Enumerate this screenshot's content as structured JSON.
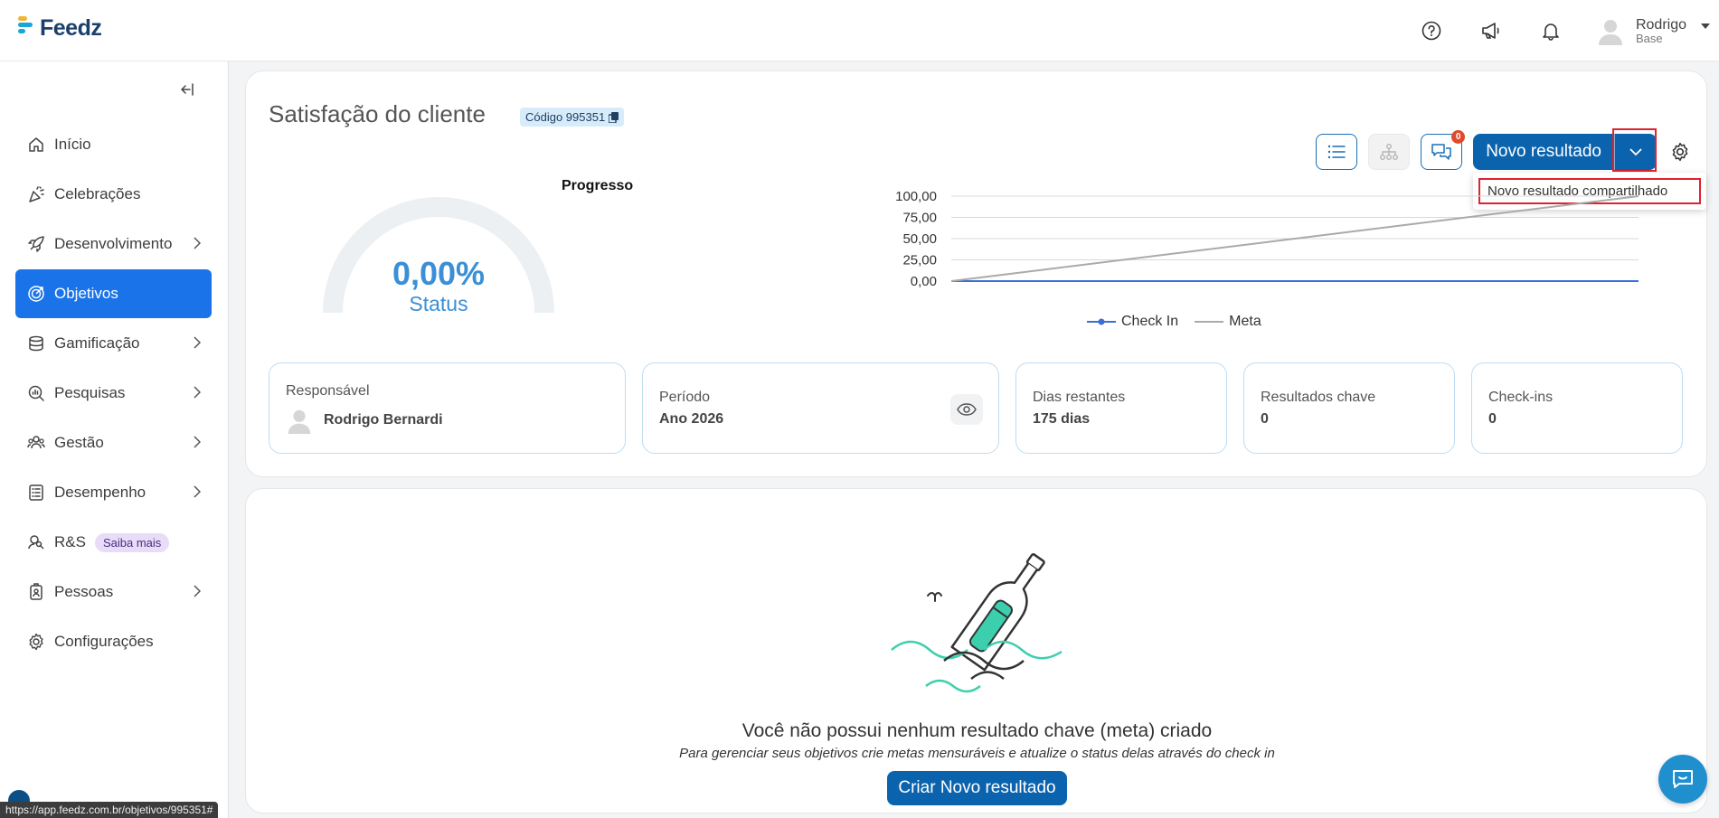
{
  "app": {
    "logo_text": "Feedz"
  },
  "header": {
    "user_name": "Rodrigo",
    "user_sub": "Base"
  },
  "sidebar": {
    "items": [
      {
        "label": "Início",
        "icon": "home-icon",
        "has_children": false
      },
      {
        "label": "Celebrações",
        "icon": "party-icon",
        "has_children": false
      },
      {
        "label": "Desenvolvimento",
        "icon": "rocket-icon",
        "has_children": true
      },
      {
        "label": "Objetivos",
        "icon": "target-icon",
        "has_children": false,
        "active": true
      },
      {
        "label": "Gamificação",
        "icon": "coins-icon",
        "has_children": true
      },
      {
        "label": "Pesquisas",
        "icon": "survey-icon",
        "has_children": true
      },
      {
        "label": "Gestão",
        "icon": "team-icon",
        "has_children": true
      },
      {
        "label": "Desempenho",
        "icon": "checklist-icon",
        "has_children": true
      },
      {
        "label": "R&S",
        "icon": "recruit-icon",
        "has_children": false,
        "badge": "Saiba mais"
      },
      {
        "label": "Pessoas",
        "icon": "badge-icon",
        "has_children": true
      },
      {
        "label": "Configurações",
        "icon": "gear-icon",
        "has_children": false
      }
    ]
  },
  "status_url": "https://app.feedz.com.br/objetivos/995351#",
  "objective": {
    "title": "Satisfação do cliente",
    "code_label": "Código 995351",
    "actions": {
      "notification_count": "0",
      "new_result_label": "Novo resultado",
      "dropdown_item": "Novo resultado compartilhado"
    },
    "gauge": {
      "value_text": "0,00%",
      "label": "Status",
      "progress": 0
    },
    "info": {
      "responsavel_label": "Responsável",
      "responsavel_value": "Rodrigo Bernardi",
      "periodo_label": "Período",
      "periodo_value": "Ano 2026",
      "dias_label": "Dias restantes",
      "dias_value": "175 dias",
      "resultados_label": "Resultados chave",
      "resultados_value": "0",
      "checkins_label": "Check-ins",
      "checkins_value": "0"
    }
  },
  "chart_data": {
    "type": "line",
    "title": "Progresso",
    "yticks": [
      "100,00",
      "75,00",
      "50,00",
      "25,00",
      "0,00"
    ],
    "ylim": [
      0,
      100
    ],
    "x": [
      0,
      1
    ],
    "series": [
      {
        "name": "Check In",
        "values": [
          0,
          0
        ],
        "color": "#3a6fd6"
      },
      {
        "name": "Meta",
        "values": [
          0,
          100
        ],
        "color": "#aaaaaa"
      }
    ],
    "legend_position": "bottom"
  },
  "empty_state": {
    "title": "Você não possui nenhum resultado chave (meta) criado",
    "subtitle": "Para gerenciar seus objetivos crie metas mensuráveis e atualize o status delas através do check in",
    "button_label": "Criar Novo resultado"
  },
  "colors": {
    "primary": "#0b63ad",
    "active_nav": "#1a73e8",
    "highlight": "#e0212e"
  }
}
